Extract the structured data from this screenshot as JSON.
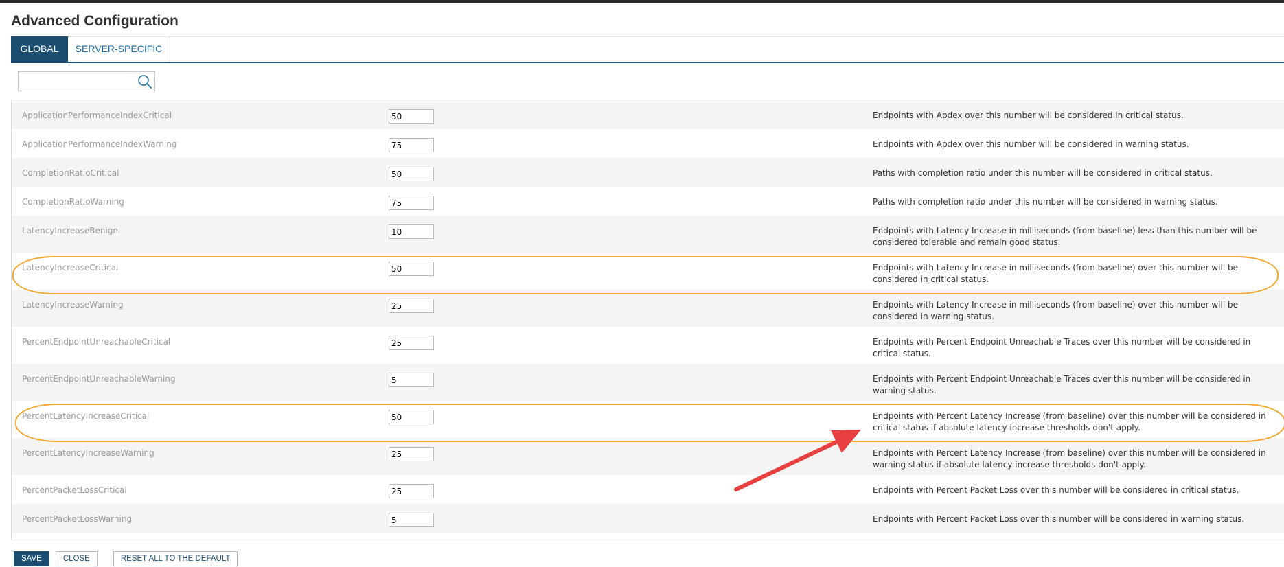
{
  "page": {
    "title": "Advanced Configuration"
  },
  "tabs": [
    {
      "label": "GLOBAL",
      "active": true
    },
    {
      "label": "SERVER-SPECIFIC",
      "active": false
    }
  ],
  "search": {
    "value": "",
    "icon": "search-icon"
  },
  "settings": [
    {
      "name": "ApplicationPerformanceIndexCritical",
      "value": "50",
      "description": "Endpoints with Apdex over this number will be considered in critical status."
    },
    {
      "name": "ApplicationPerformanceIndexWarning",
      "value": "75",
      "description": "Endpoints with Apdex over this number will be considered in warning status."
    },
    {
      "name": "CompletionRatioCritical",
      "value": "50",
      "description": "Paths with completion ratio under this number will be considered in critical status."
    },
    {
      "name": "CompletionRatioWarning",
      "value": "75",
      "description": "Paths with completion ratio under this number will be considered in warning status."
    },
    {
      "name": "LatencyIncreaseBenign",
      "value": "10",
      "description": "Endpoints with Latency Increase in milliseconds (from baseline) less than this number will be considered tolerable and remain good status."
    },
    {
      "name": "LatencyIncreaseCritical",
      "value": "50",
      "description": "Endpoints with Latency Increase in milliseconds (from baseline) over this number will be considered in critical status."
    },
    {
      "name": "LatencyIncreaseWarning",
      "value": "25",
      "description": "Endpoints with Latency Increase in milliseconds (from baseline) over this number will be considered in warning status."
    },
    {
      "name": "PercentEndpointUnreachableCritical",
      "value": "25",
      "description": "Endpoints with Percent Endpoint Unreachable Traces over this number will be considered in critical status."
    },
    {
      "name": "PercentEndpointUnreachableWarning",
      "value": "5",
      "description": "Endpoints with Percent Endpoint Unreachable Traces over this number will be considered in warning status."
    },
    {
      "name": "PercentLatencyIncreaseCritical",
      "value": "50",
      "description": "Endpoints with Percent Latency Increase (from baseline) over this number will be considered in critical status if absolute latency increase thresholds don't apply."
    },
    {
      "name": "PercentLatencyIncreaseWarning",
      "value": "25",
      "description": "Endpoints with Percent Latency Increase (from baseline) over this number will be considered in warning status if absolute latency increase thresholds don't apply."
    },
    {
      "name": "PercentPacketLossCritical",
      "value": "25",
      "description": "Endpoints with Percent Packet Loss over this number will be considered in critical status."
    },
    {
      "name": "PercentPacketLossWarning",
      "value": "5",
      "description": "Endpoints with Percent Packet Loss over this number will be considered in warning status."
    }
  ],
  "annotations": {
    "highlight_color": "#f0a830",
    "arrow_color": "#e84040"
  },
  "footer": {
    "save_label": "SAVE",
    "close_label": "CLOSE",
    "reset_label": "RESET ALL TO THE DEFAULT"
  },
  "colors": {
    "accent": "#1c4e72",
    "link": "#1c6fa6"
  }
}
